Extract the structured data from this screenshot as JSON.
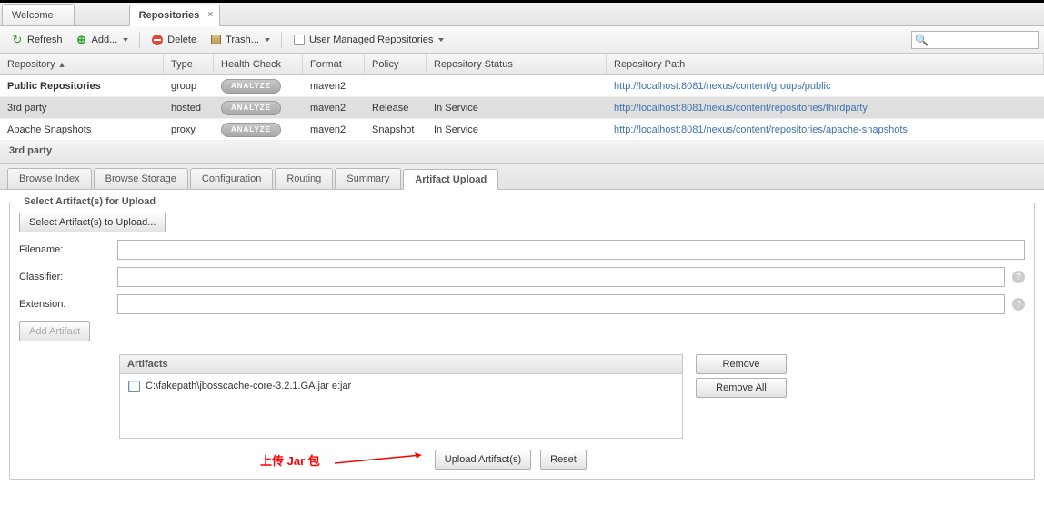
{
  "tabs": {
    "welcome": "Welcome",
    "repositories": "Repositories"
  },
  "toolbar": {
    "refresh": "Refresh",
    "add": "Add...",
    "delete": "Delete",
    "trash": "Trash...",
    "user_managed": "User Managed Repositories",
    "search_placeholder": ""
  },
  "grid": {
    "headers": {
      "repository": "Repository",
      "type": "Type",
      "health": "Health Check",
      "format": "Format",
      "policy": "Policy",
      "status": "Repository Status",
      "path": "Repository Path"
    },
    "analyze_label": "ANALYZE",
    "rows": [
      {
        "repository": "Public Repositories",
        "type": "group",
        "format": "maven2",
        "policy": "",
        "status": "",
        "path": "http://localhost:8081/nexus/content/groups/public",
        "bold": true
      },
      {
        "repository": "3rd party",
        "type": "hosted",
        "format": "maven2",
        "policy": "Release",
        "status": "In Service",
        "path": "http://localhost:8081/nexus/content/repositories/thirdparty",
        "selected": true
      },
      {
        "repository": "Apache Snapshots",
        "type": "proxy",
        "format": "maven2",
        "policy": "Snapshot",
        "status": "In Service",
        "path": "http://localhost:8081/nexus/content/repositories/apache-snapshots"
      }
    ]
  },
  "detail": {
    "title": "3rd party",
    "tabs": {
      "browse_index": "Browse Index",
      "browse_storage": "Browse Storage",
      "configuration": "Configuration",
      "routing": "Routing",
      "summary": "Summary",
      "artifact_upload": "Artifact Upload"
    }
  },
  "upload": {
    "legend": "Select Artifact(s) for Upload",
    "select_btn": "Select Artifact(s) to Upload...",
    "filename_label": "Filename:",
    "classifier_label": "Classifier:",
    "extension_label": "Extension:",
    "add_artifact": "Add Artifact",
    "artifacts_header": "Artifacts",
    "artifact_item": "C:\\fakepath\\jbosscache-core-3.2.1.GA.jar e:jar",
    "remove": "Remove",
    "remove_all": "Remove All",
    "upload_btn": "Upload Artifact(s)",
    "reset_btn": "Reset",
    "annotation": "上传 Jar 包",
    "filename_value": "",
    "classifier_value": "",
    "extension_value": ""
  }
}
